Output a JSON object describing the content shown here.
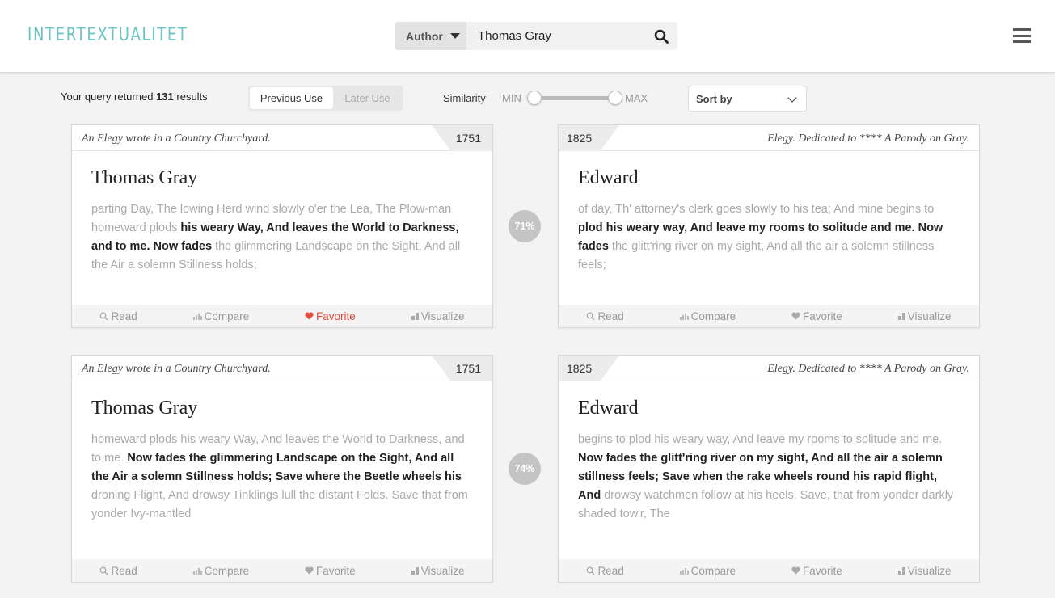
{
  "header": {
    "logo": "INTERTEXTUALITET",
    "search": {
      "category": "Author",
      "value": "Thomas Gray"
    }
  },
  "toolbar": {
    "results_prefix": "Your query returned",
    "results_count": "131",
    "results_suffix": "results",
    "toggle": {
      "previous": "Previous Use",
      "later": "Later Use",
      "active": "previous"
    },
    "similarity_label": "Similarity",
    "min_label": "MIN",
    "max_label": "MAX",
    "sort_label": "Sort by"
  },
  "actions": {
    "read": "Read",
    "compare": "Compare",
    "favorite": "Favorite",
    "visualize": "Visualize"
  },
  "colors": {
    "accent": "#6cc4c4",
    "favorite_active": "#e04b3a",
    "badge": "#c4c4c4"
  },
  "pairs": [
    {
      "similarity": "71%",
      "source": {
        "title": "An Elegy wrote in a Country Churchyard.",
        "year": "1751",
        "author": "Thomas Gray",
        "before": "parting Day, The lowing Herd wind slowly o'er the Lea, The Plow-man homeward plods ",
        "match": "his weary Way, And leaves the World to Darkness, and to me. Now fades",
        "after": " the glimmering Landscape on the Sight, And all the Air a solemn Stillness holds;",
        "favorited": true
      },
      "target": {
        "title": "Elegy. Dedicated to **** A Parody on Gray.",
        "year": "1825",
        "author": "Edward",
        "before": "of day, Th' attorney's clerk goes slowly to his tea; And mine begins to ",
        "match": "plod his weary way, And leave my rooms to solitude and me. Now fades",
        "after": " the glitt'ring river on my sight, And all the air a solemn stillness feels;",
        "favorited": false
      }
    },
    {
      "similarity": "74%",
      "source": {
        "title": "An Elegy wrote in a Country Churchyard.",
        "year": "1751",
        "author": "Thomas Gray",
        "before": "homeward plods his weary Way, And leaves the World to Darkness, and to me. ",
        "match": "Now fades the glimmering Landscape on the Sight, And all the Air a solemn Stillness holds; Save where the Beetle wheels his",
        "after": " droning Flight, And drowsy Tinklings lull the distant Folds. Save that from yonder Ivy-mantled",
        "favorited": false
      },
      "target": {
        "title": "Elegy. Dedicated to **** A Parody on Gray.",
        "year": "1825",
        "author": "Edward",
        "before": "begins to plod his weary way, And leave my rooms to solitude and me. ",
        "match": "Now fades the glitt'ring river on my sight, And all the air a solemn stillness feels; Save when the rake wheels round his rapid flight, And",
        "after": " drowsy watchmen follow at his heels. Save, that from yonder darkly shaded tow'r, The",
        "favorited": false
      }
    }
  ]
}
